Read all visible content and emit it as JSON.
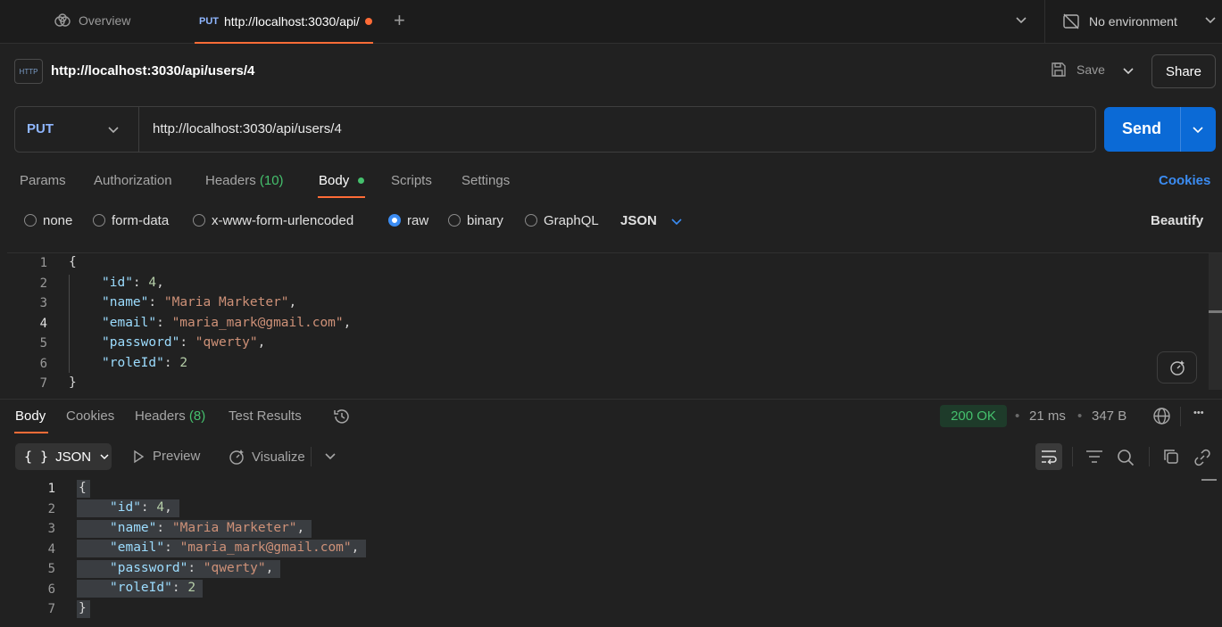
{
  "tabs": {
    "overview_label": "Overview",
    "active_method": "PUT",
    "active_url": "http://localhost:3030/api/users/4"
  },
  "environment": {
    "label": "No environment"
  },
  "request": {
    "icon_text": "HTTP",
    "title": "http://localhost:3030/api/users/4",
    "save_label": "Save",
    "share_label": "Share",
    "method": "PUT",
    "url": "http://localhost:3030/api/users/4",
    "send_label": "Send"
  },
  "request_tabs": {
    "params": "Params",
    "authorization": "Authorization",
    "headers": "Headers",
    "headers_count": "(10)",
    "body": "Body",
    "scripts": "Scripts",
    "settings": "Settings",
    "cookies": "Cookies"
  },
  "body_types": {
    "none": "none",
    "form_data": "form-data",
    "urlencoded": "x-www-form-urlencoded",
    "raw": "raw",
    "binary": "binary",
    "graphql": "GraphQL",
    "format": "JSON",
    "beautify": "Beautify",
    "selected": "raw"
  },
  "request_body": {
    "line_numbers": [
      "1",
      "2",
      "3",
      "4",
      "5",
      "6",
      "7"
    ],
    "open_brace": "{",
    "close_brace": "}",
    "fields": [
      {
        "key": "\"id\"",
        "value": "4",
        "type": "number"
      },
      {
        "key": "\"name\"",
        "value": "\"Maria Marketer\"",
        "type": "string"
      },
      {
        "key": "\"email\"",
        "value": "\"maria_mark@gmail.com\"",
        "type": "string"
      },
      {
        "key": "\"password\"",
        "value": "\"qwerty\"",
        "type": "string"
      },
      {
        "key": "\"roleId\"",
        "value": "2",
        "type": "number"
      }
    ]
  },
  "response_tabs": {
    "body": "Body",
    "cookies": "Cookies",
    "headers": "Headers",
    "headers_count": "(8)",
    "test_results": "Test Results"
  },
  "response_meta": {
    "status": "200 OK",
    "time": "21 ms",
    "size": "347 B",
    "separator": "•",
    "more": "•••"
  },
  "response_view": {
    "format_icon": "{ }",
    "format": "JSON",
    "preview": "Preview",
    "visualize": "Visualize"
  },
  "response_body": {
    "line_numbers": [
      "1",
      "2",
      "3",
      "4",
      "5",
      "6",
      "7"
    ],
    "open_brace": "{",
    "close_brace": "}",
    "fields": [
      {
        "key": "\"id\"",
        "value": "4",
        "type": "number"
      },
      {
        "key": "\"name\"",
        "value": "\"Maria Marketer\"",
        "type": "string"
      },
      {
        "key": "\"email\"",
        "value": "\"maria_mark@gmail.com\"",
        "type": "string"
      },
      {
        "key": "\"password\"",
        "value": "\"qwerty\"",
        "type": "string"
      },
      {
        "key": "\"roleId\"",
        "value": "2",
        "type": "number"
      }
    ]
  },
  "colors": {
    "accent_orange": "#ff6c37",
    "send_blue": "#0b6ad6",
    "link_blue": "#3b8cf2",
    "success_green": "#45c06d"
  },
  "icons": [
    "overview-icon",
    "plus-icon",
    "chevron-down-icon",
    "no-environment-icon",
    "http-icon",
    "save-icon",
    "ai-assist-icon",
    "history-icon",
    "globe-icon",
    "play-icon",
    "visualize-icon",
    "wrap-icon",
    "filter-icon",
    "search-icon",
    "copy-icon",
    "link-icon"
  ]
}
